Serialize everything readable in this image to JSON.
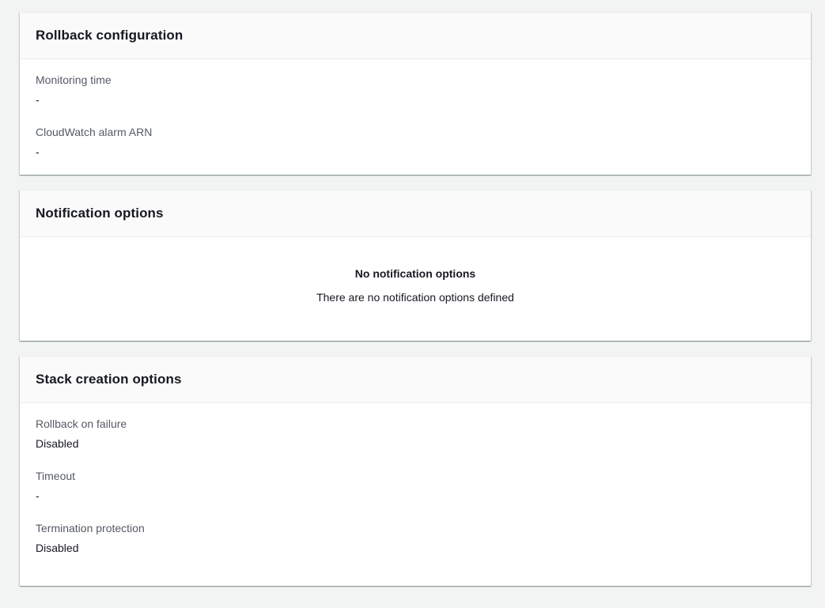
{
  "rollback": {
    "title": "Rollback configuration",
    "fields": [
      {
        "label": "Monitoring time",
        "value": "-"
      },
      {
        "label": "CloudWatch alarm ARN",
        "value": "-"
      }
    ]
  },
  "notification": {
    "title": "Notification options",
    "empty_title": "No notification options",
    "empty_description": "There are no notification options defined"
  },
  "stack_creation": {
    "title": "Stack creation options",
    "fields": [
      {
        "label": "Rollback on failure",
        "value": "Disabled"
      },
      {
        "label": "Timeout",
        "value": "-"
      },
      {
        "label": "Termination protection",
        "value": "Disabled"
      }
    ]
  }
}
